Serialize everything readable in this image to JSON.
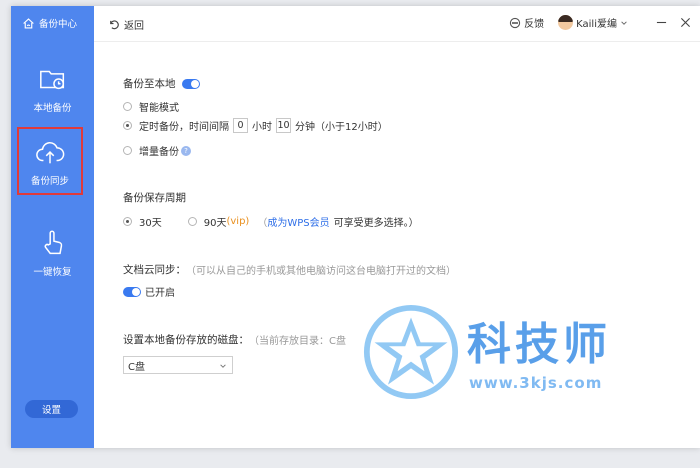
{
  "sidebar": {
    "brand": "备份中心",
    "items": [
      {
        "label": "本地备份",
        "icon": "folder-clock-icon"
      },
      {
        "label": "备份同步",
        "icon": "cloud-upload-icon"
      },
      {
        "label": "一键恢复",
        "icon": "hand-pointer-icon"
      }
    ],
    "settings_label": "设置"
  },
  "topbar": {
    "back_label": "返回",
    "feedback_label": "反馈",
    "user_name": "Kaili爱编"
  },
  "local_backup": {
    "title": "备份至本地",
    "enabled": true,
    "options": {
      "smart": "智能模式",
      "timed_prefix": "定时备份，时间间隔",
      "hours_value": "0",
      "hours_unit": "小时",
      "minutes_value": "10",
      "minutes_unit": "分钟（小于12小时）",
      "incremental": "增量备份"
    },
    "selected": "timed"
  },
  "retention": {
    "title": "备份保存周期",
    "opt_30": "30天",
    "opt_90": "90天",
    "vip_tag": "(vip)",
    "hint_open": "（",
    "member_link": "成为WPS会员",
    "hint_rest": "可享受更多选择。）",
    "selected": "30"
  },
  "cloud_sync": {
    "title": "文档云同步：",
    "hint": "（可以从自己的手机或其他电脑访问这台电脑打开过的文档）",
    "status": "已开启"
  },
  "disk": {
    "title": "设置本地备份存放的磁盘：",
    "hint": "（当前存放目录：C盘",
    "selected": "C盘"
  },
  "watermark": {
    "text": "科技师",
    "url": "www.3kjs.com"
  },
  "colors": {
    "sidebar": "#4f86ee",
    "accent": "#3a7af0",
    "highlight_border": "#e03a3a"
  }
}
